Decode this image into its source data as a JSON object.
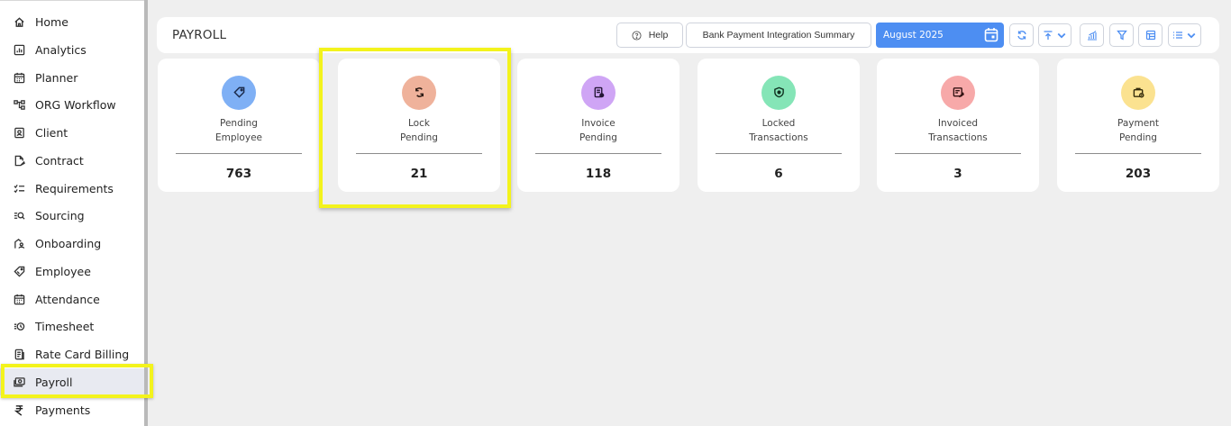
{
  "sidebar": {
    "items": [
      {
        "label": "Home",
        "icon": "home-icon"
      },
      {
        "label": "Analytics",
        "icon": "analytics-icon"
      },
      {
        "label": "Planner",
        "icon": "calendar-icon"
      },
      {
        "label": "ORG Workflow",
        "icon": "workflow-icon"
      },
      {
        "label": "Client",
        "icon": "client-icon"
      },
      {
        "label": "Contract",
        "icon": "contract-icon"
      },
      {
        "label": "Requirements",
        "icon": "checklist-icon"
      },
      {
        "label": "Sourcing",
        "icon": "search-list-icon"
      },
      {
        "label": "Onboarding",
        "icon": "onboarding-icon"
      },
      {
        "label": "Employee",
        "icon": "tag-icon"
      },
      {
        "label": "Attendance",
        "icon": "calendar-icon"
      },
      {
        "label": "Timesheet",
        "icon": "clock-list-icon"
      },
      {
        "label": "Rate Card Billing",
        "icon": "document-icon"
      },
      {
        "label": "Payroll",
        "icon": "payroll-icon",
        "active": true
      },
      {
        "label": "Payments",
        "icon": "rupee-icon"
      }
    ]
  },
  "header": {
    "title": "PAYROLL",
    "help_label": "Help",
    "bank_summary_label": "Bank Payment Integration Summary",
    "period": "August 2025"
  },
  "cards": [
    {
      "line1": "Pending",
      "line2": "Employee",
      "value": "763",
      "color": "#7fb0f5",
      "icon": "tag-icon"
    },
    {
      "line1": "Lock",
      "line2": "Pending",
      "value": "21",
      "color": "#efb29b",
      "icon": "lock-swap-icon"
    },
    {
      "line1": "Invoice",
      "line2": "Pending",
      "value": "118",
      "color": "#cfa5f5",
      "icon": "invoice-icon"
    },
    {
      "line1": "Locked",
      "line2": "Transactions",
      "value": "6",
      "color": "#85e5b7",
      "icon": "shield-icon"
    },
    {
      "line1": "Invoiced",
      "line2": "Transactions",
      "value": "3",
      "color": "#f7a9a9",
      "icon": "invoice-edit-icon"
    },
    {
      "line1": "Payment",
      "line2": "Pending",
      "value": "203",
      "color": "#fbe290",
      "icon": "briefcase-clock-icon"
    }
  ],
  "colors": {
    "accent": "#4d8ef2",
    "highlight": "#f3f31c"
  }
}
